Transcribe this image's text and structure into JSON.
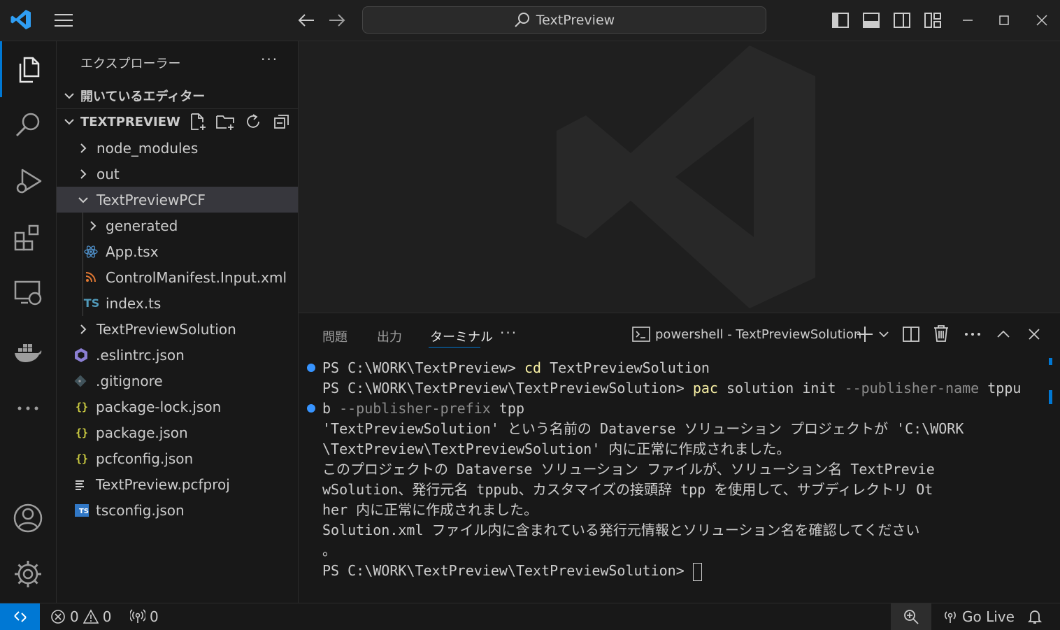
{
  "titlebar": {
    "search_text": "TextPreview",
    "icons": [
      "vscode-logo-icon",
      "menu-icon",
      "back-arrow-icon",
      "forward-arrow-icon",
      "search-icon",
      "toggle-primary-sidebar-icon",
      "toggle-panel-icon",
      "toggle-secondary-sidebar-icon",
      "customize-layout-icon",
      "minimize-icon",
      "maximize-icon",
      "close-icon"
    ]
  },
  "activity_bar": {
    "items": [
      "explorer-icon",
      "search-icon",
      "run-debug-icon",
      "extensions-icon",
      "remote-explorer-icon",
      "docker-icon",
      "more-icon",
      "accounts-icon",
      "settings-gear-icon"
    ]
  },
  "explorer": {
    "title": "エクスプローラー",
    "more_label": "···",
    "open_editors_label": "開いているエディター",
    "project_label": "TEXTPREVIEW",
    "tree": [
      {
        "label": "node_modules",
        "kind": "folder"
      },
      {
        "label": "out",
        "kind": "folder"
      },
      {
        "label": "TextPreviewPCF",
        "kind": "folder-open",
        "selected": true
      },
      {
        "label": "generated",
        "kind": "folder"
      },
      {
        "label": "App.tsx",
        "kind": "react"
      },
      {
        "label": "ControlManifest.Input.xml",
        "kind": "xml"
      },
      {
        "label": "index.ts",
        "kind": "ts",
        "badge": "TS"
      },
      {
        "label": "TextPreviewSolution",
        "kind": "folder"
      },
      {
        "label": ".eslintrc.json",
        "kind": "eslint"
      },
      {
        "label": ".gitignore",
        "kind": "git"
      },
      {
        "label": "package-lock.json",
        "kind": "json",
        "badge": "{}"
      },
      {
        "label": "package.json",
        "kind": "json",
        "badge": "{}"
      },
      {
        "label": "pcfconfig.json",
        "kind": "json",
        "badge": "{}"
      },
      {
        "label": "TextPreview.pcfproj",
        "kind": "proj"
      },
      {
        "label": "tsconfig.json",
        "kind": "tsconfig",
        "badge": "TS"
      }
    ]
  },
  "panel": {
    "tabs": [
      "問題",
      "出力",
      "ターミナル"
    ],
    "active_tab": "ターミナル",
    "more_label": "···",
    "terminal_name": "powershell - TextPreviewSolution",
    "terminal": {
      "l1_prompt": "PS C:\\WORK\\TextPreview> ",
      "l1_cmd": "cd",
      "l1_rest": " TextPreviewSolution",
      "l2_prompt": "PS C:\\WORK\\TextPreview\\TextPreviewSolution> ",
      "l2_cmd": "pac",
      "l2_mid": " solution init ",
      "l2_flag": "--publisher-name",
      "l2_end": " tppu",
      "l3_start": "b ",
      "l3_flag": "--publisher-prefix",
      "l3_end": " tpp",
      "l4": "'TextPreviewSolution' という名前の Dataverse ソリューション プロジェクトが 'C:\\WORK",
      "l5": "\\TextPreview\\TextPreviewSolution' 内に正常に作成されました。",
      "l6": "このプロジェクトの Dataverse ソリューション ファイルが、ソリューション名 TextPrevie",
      "l7": "wSolution、発行元名 tppub、カスタマイズの接頭辞 tpp を使用して、サブディレクトリ Ot",
      "l8": "her 内に正常に作成されました。",
      "l9": "Solution.xml ファイル内に含まれている発行元情報とソリューション名を確認してください",
      "l10": "。",
      "l11": "PS C:\\WORK\\TextPreview\\TextPreviewSolution> "
    }
  },
  "status_bar": {
    "errors": "0",
    "warnings": "0",
    "ports": "0",
    "go_live": "Go Live"
  },
  "colors": {
    "accent": "#0078d4",
    "terminal_dot": "#3794ff",
    "command": "#f9f1a5",
    "remote_bg": "#0078d4"
  }
}
